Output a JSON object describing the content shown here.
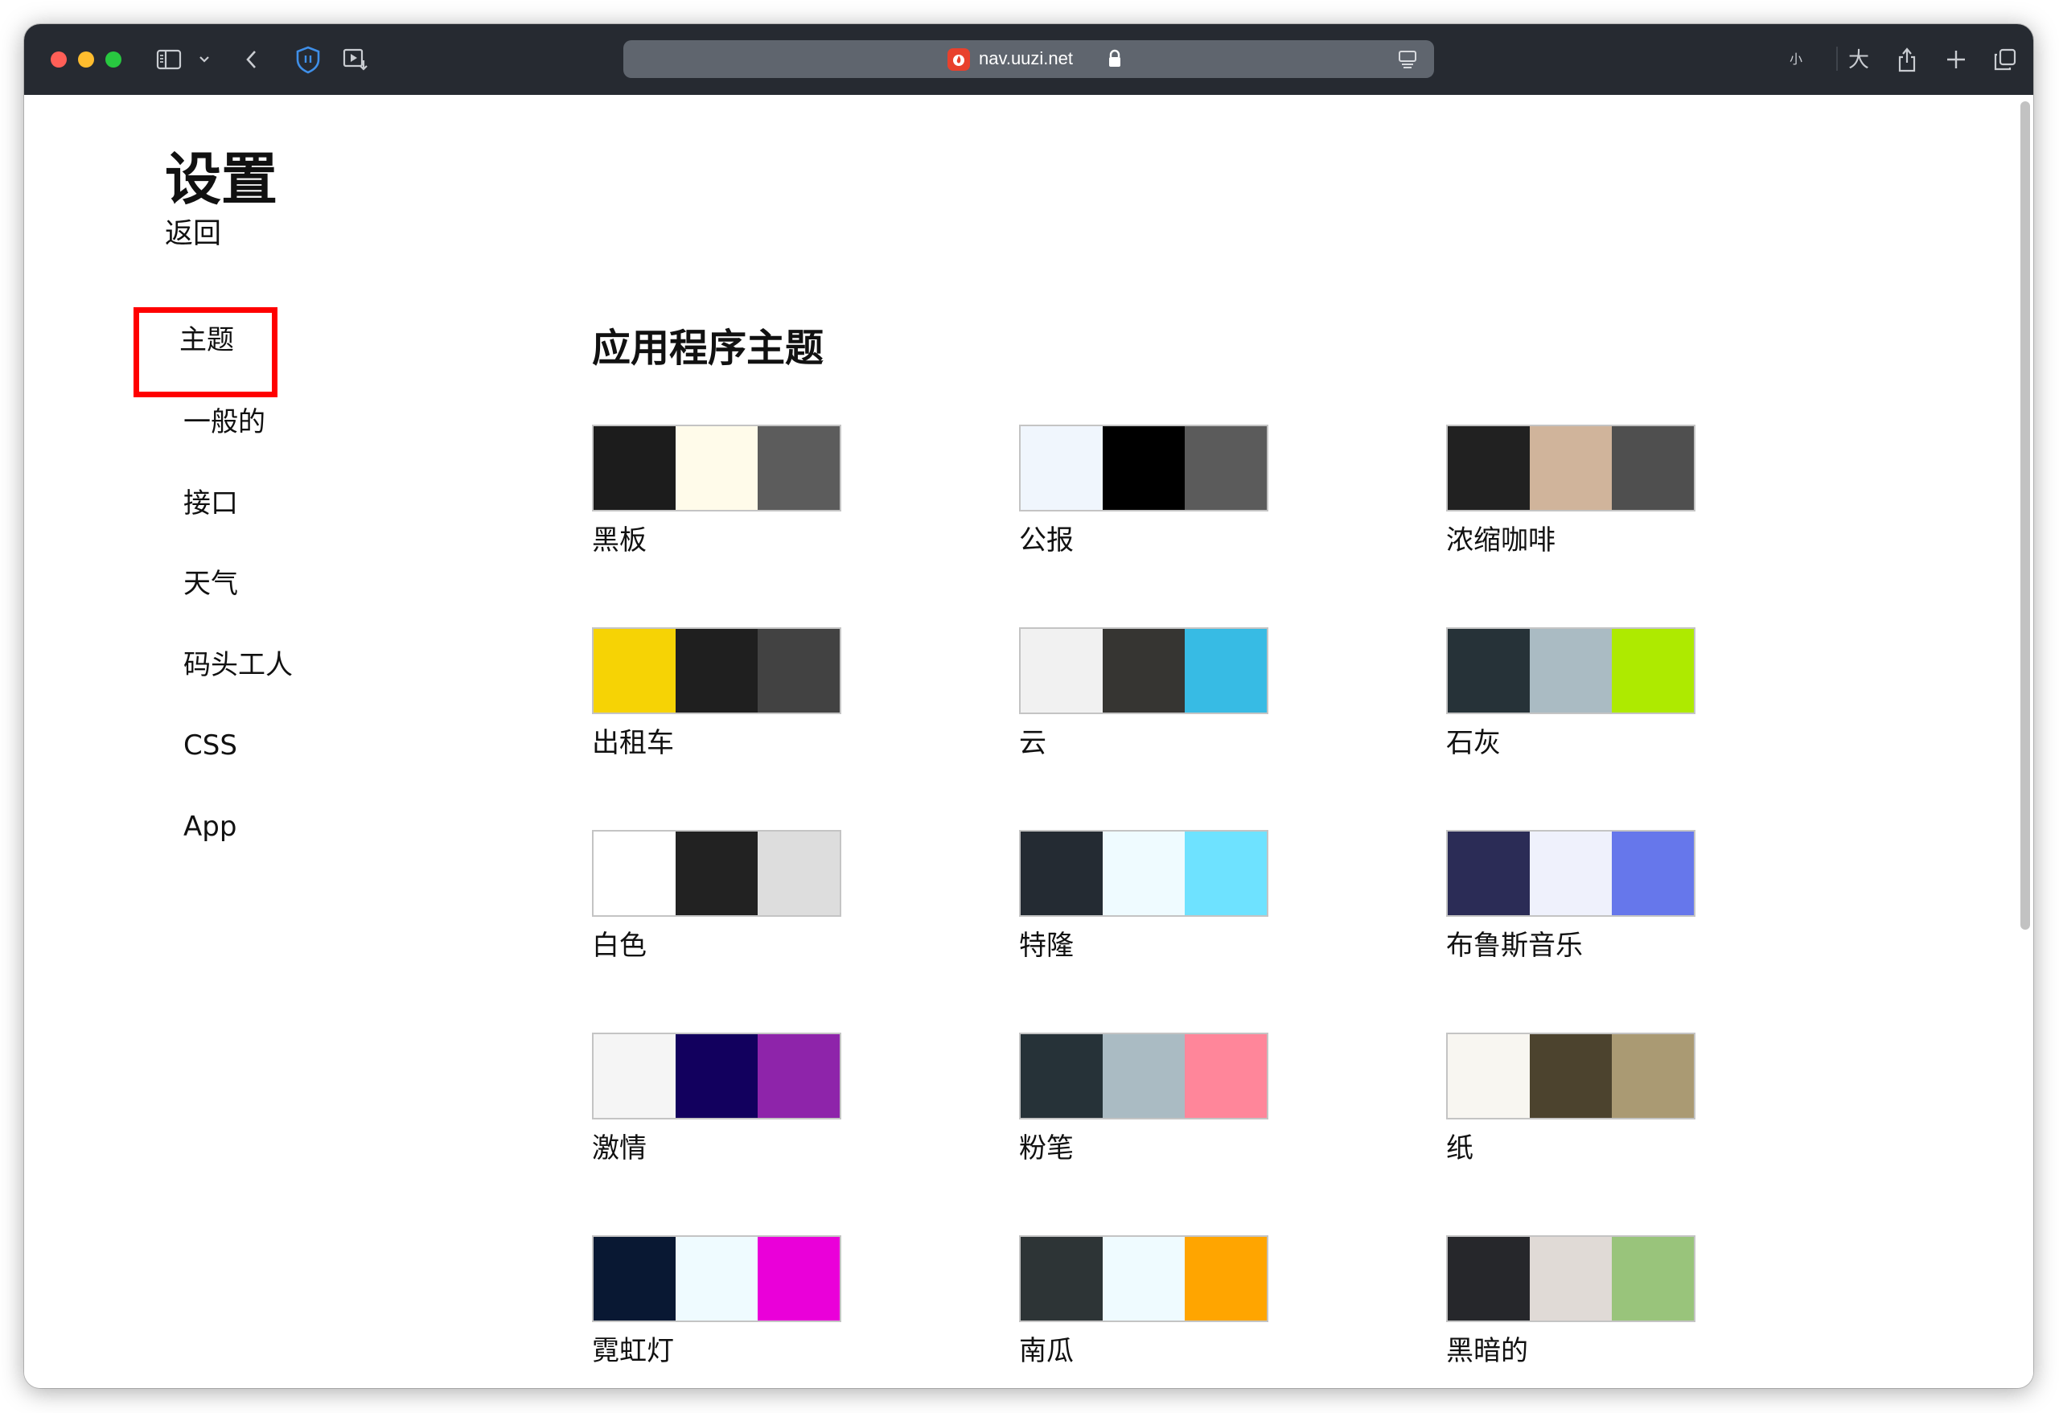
{
  "browser": {
    "url": "nav.uuzi.net",
    "font_small_label": "小",
    "font_large_label": "大"
  },
  "page": {
    "title": "设置",
    "back_label": "返回"
  },
  "sidebar": {
    "active_index": 0,
    "items": [
      {
        "label": "主题"
      },
      {
        "label": "一般的"
      },
      {
        "label": "接口"
      },
      {
        "label": "天气"
      },
      {
        "label": "码头工人"
      },
      {
        "label": "CSS"
      },
      {
        "label": "App"
      }
    ]
  },
  "main": {
    "section_title": "应用程序主题",
    "themes": [
      {
        "name": "黑板",
        "colors": [
          "#1c1c1c",
          "#fffbea",
          "#5c5c5c"
        ]
      },
      {
        "name": "公报",
        "colors": [
          "#f0f6fd",
          "#000000",
          "#5b5b5b"
        ]
      },
      {
        "name": "浓缩咖啡",
        "colors": [
          "#212121",
          "#d0b49b",
          "#4f4f4f"
        ]
      },
      {
        "name": "出租车",
        "colors": [
          "#f6d305",
          "#1f1f1f",
          "#424242"
        ]
      },
      {
        "name": "云",
        "colors": [
          "#f1f1f1",
          "#363532",
          "#37bbe4"
        ]
      },
      {
        "name": "石灰",
        "colors": [
          "#263238",
          "#aabbc3",
          "#aeea00"
        ]
      },
      {
        "name": "白色",
        "colors": [
          "#ffffff",
          "#222222",
          "#dddddd"
        ]
      },
      {
        "name": "特隆",
        "colors": [
          "#242b33",
          "#effbff",
          "#6ee2ff"
        ]
      },
      {
        "name": "布鲁斯音乐",
        "colors": [
          "#2b2c56",
          "#eff1fc",
          "#6677eb"
        ]
      },
      {
        "name": "激情",
        "colors": [
          "#f5f5f5",
          "#12005e",
          "#8e24aa"
        ]
      },
      {
        "name": "粉笔",
        "colors": [
          "#263238",
          "#aabbc3",
          "#ff869a"
        ]
      },
      {
        "name": "纸",
        "colors": [
          "#f8f6f1",
          "#4c432e",
          "#aa9a73"
        ]
      },
      {
        "name": "霓虹灯",
        "colors": [
          "#091833",
          "#effbff",
          "#ea00d9"
        ]
      },
      {
        "name": "南瓜",
        "colors": [
          "#2d3436",
          "#effbff",
          "#ffa500"
        ]
      },
      {
        "name": "黑暗的",
        "colors": [
          "#26272b",
          "#e0dad6",
          "#99c47b"
        ]
      }
    ]
  }
}
